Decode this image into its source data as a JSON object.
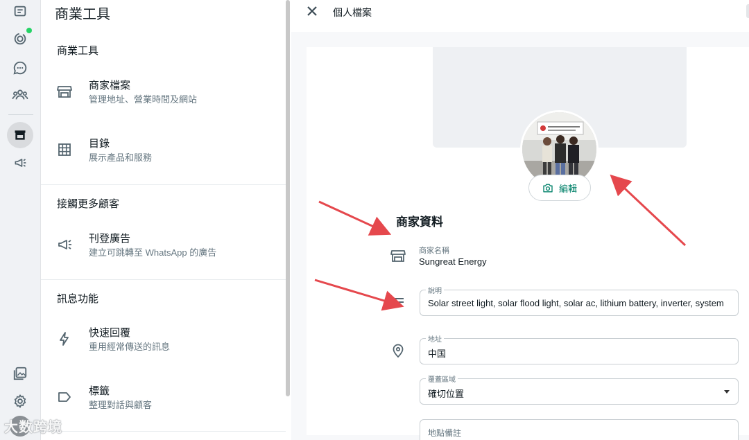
{
  "tools": {
    "title": "商業工具",
    "sections": [
      {
        "heading": "商業工具",
        "items": [
          {
            "label": "商家檔案",
            "sub": "管理地址、營業時間及網站",
            "icon": "storefront-icon"
          },
          {
            "label": "目錄",
            "sub": "展示產品和服務",
            "icon": "catalog-grid-icon"
          }
        ]
      },
      {
        "heading": "接觸更多顧客",
        "items": [
          {
            "label": "刊登廣告",
            "sub": "建立可跳轉至 WhatsApp 的廣告",
            "icon": "megaphone-icon"
          }
        ]
      },
      {
        "heading": "訊息功能",
        "items": [
          {
            "label": "快速回覆",
            "sub": "重用經常傳送的訊息",
            "icon": "lightning-icon"
          },
          {
            "label": "標籤",
            "sub": "整理對話與顧客",
            "icon": "label-icon"
          }
        ]
      }
    ]
  },
  "profile": {
    "title": "個人檔案",
    "edit_label": "編輯",
    "section_title": "商家資料",
    "business_name_label": "商家名稱",
    "business_name": "Sungreat Energy",
    "description_label": "說明",
    "description": "Solar street light, solar flood light, solar ac, lithium battery, inverter, system",
    "address_label": "地址",
    "address": "中国",
    "service_area_label": "覆蓋區域",
    "service_area": "確切位置",
    "location_note_label": "地點備註"
  },
  "watermark": "大数跨境",
  "colors": {
    "accent": "#008069",
    "notification_dot": "#25d366",
    "annotation_arrow": "#e5484d"
  }
}
